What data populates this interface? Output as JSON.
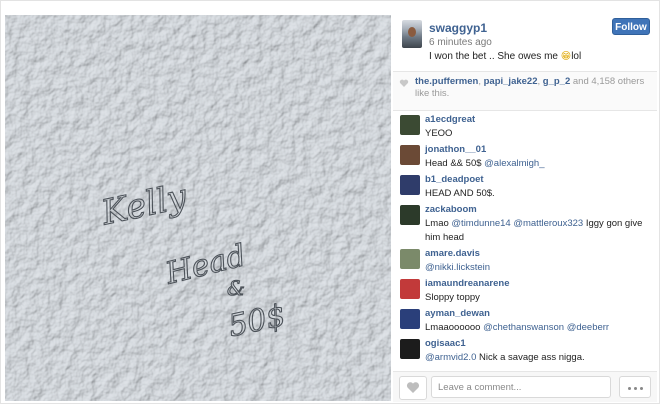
{
  "post": {
    "username": "swaggyp1",
    "time_ago": "6 minutes ago",
    "caption_text": "I won the bet .. She owes me",
    "caption_emoji": "😁",
    "caption_suffix": "lol",
    "follow_label": "Follow"
  },
  "photo": {
    "handwriting": [
      "Kelly",
      "Head",
      "&",
      "50$"
    ]
  },
  "likes": {
    "users": [
      "the.puffermen",
      "papi_jake22",
      "g_p_2"
    ],
    "sep1": ", ",
    "sep2": ", ",
    "and_text": " and ",
    "count": "4,158",
    "others_text": " others like this."
  },
  "comments": [
    {
      "user": "a1ecdgreat",
      "text": "YEOO",
      "avatar_color": "#3b4a33"
    },
    {
      "user": "jonathon__01",
      "before": "Head && 50$ ",
      "mention": "@alexalmigh_",
      "after": "",
      "avatar_color": "#6b4a36"
    },
    {
      "user": "b1_deadpoet",
      "text": "HEAD AND 50$.",
      "avatar_color": "#2f3c6a"
    },
    {
      "user": "zackaboom",
      "before": "Lmao ",
      "mention": "@timdunne14",
      "mid": " ",
      "mention2": "@mattleroux323",
      "after": " Iggy gon give him head",
      "avatar_color": "#2c3a2a"
    },
    {
      "user": "amare.davis",
      "mention": "@nikki.lickstein",
      "avatar_color": "#7b8a6a"
    },
    {
      "user": "iamaundreanarene",
      "text": "Sloppy toppy",
      "avatar_color": "#c23a3a"
    },
    {
      "user": "ayman_dewan",
      "before": "Lmaaoooooo ",
      "mention": "@chethanswanson",
      "mid": " ",
      "mention2": "@deeberr",
      "after": "",
      "avatar_color": "#2a3f7a"
    },
    {
      "user": "ogisaac1",
      "mention": "@armvid2.0",
      "after": " Nick a savage ass nigga.",
      "avatar_color": "#1c1c1c"
    }
  ],
  "footer": {
    "comment_placeholder": "Leave a comment..."
  },
  "colors": {
    "link": "#3f6291",
    "follow_button": "#3f74b8"
  },
  "icons": {
    "like": "heart-icon",
    "more": "ellipsis-icon"
  }
}
